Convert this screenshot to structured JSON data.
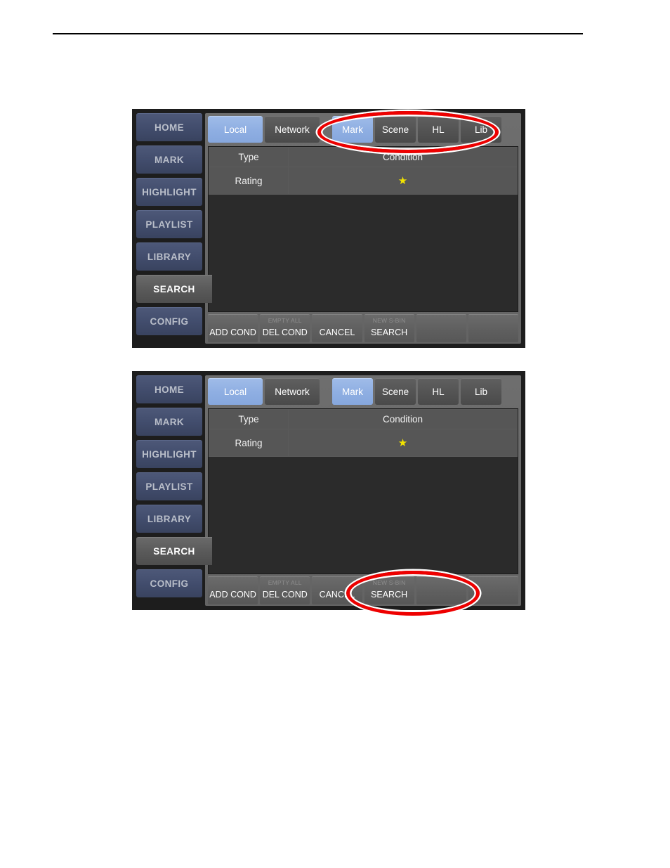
{
  "page": {
    "background_color": "#ffffff",
    "header_rule_color": "#000000"
  },
  "colors": {
    "panel_background": "#1d1d1d",
    "sidebar_button": "#424d6d",
    "sidebar_button_active": "#5a5a5a",
    "tab_unselected": "#545454",
    "tab_selected": "#8eaee2",
    "content_background": "#646464",
    "table_background": "#2b2b2b",
    "table_cell": "#565656",
    "star_yellow": "#f2e300",
    "annotation_red": "#ee0000"
  },
  "panels": [
    {
      "id": "panel-one",
      "annotation": "tabs-group-highlight",
      "sidebar": {
        "items": [
          {
            "label": "HOME",
            "active": false
          },
          {
            "label": "MARK",
            "active": false
          },
          {
            "label": "HIGHLIGHT",
            "active": false
          },
          {
            "label": "PLAYLIST",
            "active": false
          },
          {
            "label": "LIBRARY",
            "active": false
          },
          {
            "label": "SEARCH",
            "active": true
          },
          {
            "label": "CONFIG",
            "active": false
          }
        ]
      },
      "tabs": [
        {
          "label": "Local",
          "selected": true
        },
        {
          "label": "Network",
          "selected": false
        },
        {
          "label": "Mark",
          "selected": true
        },
        {
          "label": "Scene",
          "selected": false
        },
        {
          "label": "HL",
          "selected": false
        },
        {
          "label": "Lib",
          "selected": false
        }
      ],
      "table": {
        "headers": [
          "Type",
          "Condition"
        ],
        "rows": [
          {
            "type": "Rating",
            "condition_icon": "star",
            "condition_value": "★"
          }
        ]
      },
      "toolbar": [
        {
          "sub_label": "",
          "main_label": "ADD COND"
        },
        {
          "sub_label": "EMPTY ALL",
          "main_label": "DEL COND"
        },
        {
          "sub_label": "",
          "main_label": "CANCEL"
        },
        {
          "sub_label": "NEW S-BIN",
          "main_label": "SEARCH"
        },
        {
          "sub_label": "",
          "main_label": ""
        },
        {
          "sub_label": "",
          "main_label": ""
        }
      ]
    },
    {
      "id": "panel-two",
      "annotation": "search-button-highlight",
      "sidebar": {
        "items": [
          {
            "label": "HOME",
            "active": false
          },
          {
            "label": "MARK",
            "active": false
          },
          {
            "label": "HIGHLIGHT",
            "active": false
          },
          {
            "label": "PLAYLIST",
            "active": false
          },
          {
            "label": "LIBRARY",
            "active": false
          },
          {
            "label": "SEARCH",
            "active": true
          },
          {
            "label": "CONFIG",
            "active": false
          }
        ]
      },
      "tabs": [
        {
          "label": "Local",
          "selected": true
        },
        {
          "label": "Network",
          "selected": false
        },
        {
          "label": "Mark",
          "selected": true
        },
        {
          "label": "Scene",
          "selected": false
        },
        {
          "label": "HL",
          "selected": false
        },
        {
          "label": "Lib",
          "selected": false
        }
      ],
      "table": {
        "headers": [
          "Type",
          "Condition"
        ],
        "rows": [
          {
            "type": "Rating",
            "condition_icon": "star",
            "condition_value": "★"
          }
        ]
      },
      "toolbar": [
        {
          "sub_label": "",
          "main_label": "ADD COND"
        },
        {
          "sub_label": "EMPTY ALL",
          "main_label": "DEL COND"
        },
        {
          "sub_label": "",
          "main_label": "CANCEL"
        },
        {
          "sub_label": "NEW S-BIN",
          "main_label": "SEARCH"
        },
        {
          "sub_label": "",
          "main_label": ""
        },
        {
          "sub_label": "",
          "main_label": ""
        }
      ]
    }
  ]
}
